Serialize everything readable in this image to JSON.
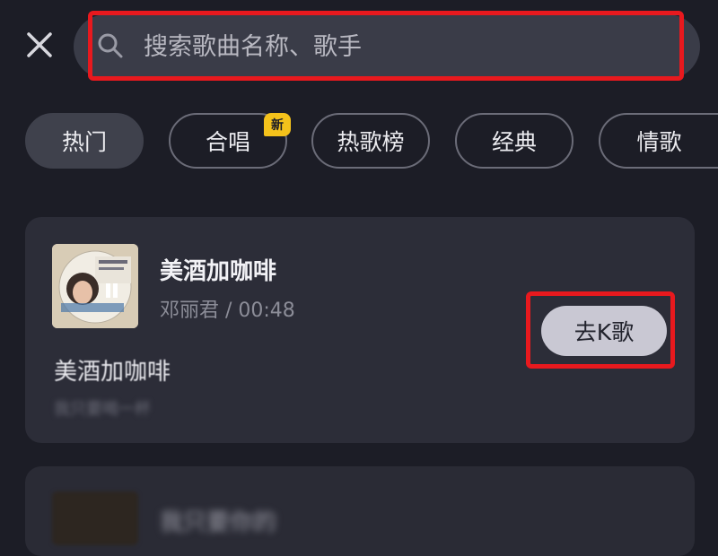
{
  "search": {
    "placeholder": "搜索歌曲名称、歌手"
  },
  "tabs": [
    {
      "label": "热门",
      "active": true
    },
    {
      "label": "合唱",
      "badge": "新"
    },
    {
      "label": "热歌榜"
    },
    {
      "label": "经典"
    },
    {
      "label": "情歌"
    }
  ],
  "songs": [
    {
      "title": "美酒加咖啡",
      "meta": "邓丽君 / 00:48",
      "action_label": "去K歌",
      "lyric": "美酒加咖啡",
      "lyric_sub": "我只要喝一杯"
    },
    {
      "title": "我只要你的"
    }
  ],
  "icons": {
    "close": "close-icon",
    "search": "search-icon"
  },
  "colors": {
    "background": "#1c1d26",
    "highlight_box": "#e8191e",
    "badge": "#f4c21b"
  }
}
